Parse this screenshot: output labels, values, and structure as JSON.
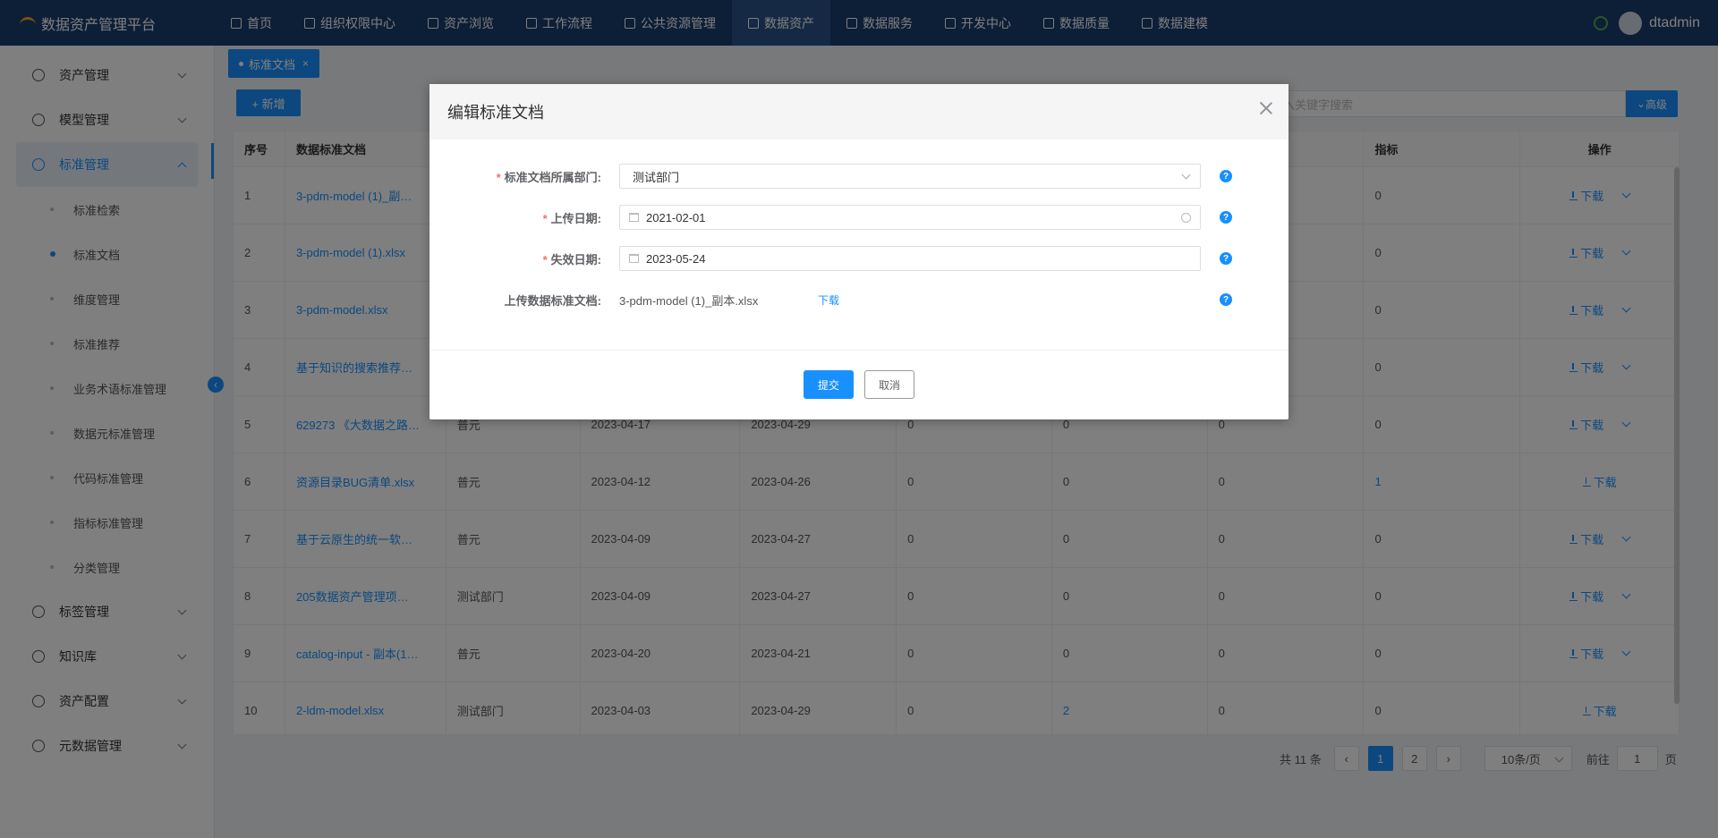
{
  "header": {
    "app_title": "数据资产管理平台",
    "nav": [
      {
        "label": "首页",
        "icon": "home-icon"
      },
      {
        "label": "组织权限中心",
        "icon": "shield-icon"
      },
      {
        "label": "资产浏览",
        "icon": "list-icon"
      },
      {
        "label": "工作流程",
        "icon": "flow-icon"
      },
      {
        "label": "公共资源管理",
        "icon": "resource-icon"
      },
      {
        "label": "数据资产",
        "icon": "asset-icon",
        "active": true
      },
      {
        "label": "数据服务",
        "icon": "service-icon"
      },
      {
        "label": "开发中心",
        "icon": "edit-icon"
      },
      {
        "label": "数据质量",
        "icon": "chart-icon"
      },
      {
        "label": "数据建模",
        "icon": "layers-icon"
      }
    ],
    "username": "dtadmin"
  },
  "sidebar": {
    "items": [
      {
        "label": "资产管理",
        "icon": "clock-icon"
      },
      {
        "label": "模型管理",
        "icon": "model-icon"
      },
      {
        "label": "标准管理",
        "icon": "document-icon",
        "open": true
      },
      {
        "label": "标签管理",
        "icon": "plus-circle-icon"
      },
      {
        "label": "知识库",
        "icon": "tag-icon"
      },
      {
        "label": "资产配置",
        "icon": "target-icon"
      },
      {
        "label": "元数据管理",
        "icon": "layers-icon"
      }
    ],
    "sub_items": [
      {
        "label": "标准检索"
      },
      {
        "label": "标准文档",
        "active": true
      },
      {
        "label": "维度管理"
      },
      {
        "label": "标准推荐"
      },
      {
        "label": "业务术语标准管理"
      },
      {
        "label": "数据元标准管理"
      },
      {
        "label": "代码标准管理"
      },
      {
        "label": "指标标准管理"
      },
      {
        "label": "分类管理"
      }
    ]
  },
  "tab": {
    "label": "标准文档",
    "close": "×"
  },
  "toolbar": {
    "add_label": "+ 新增",
    "search_placeholder": "入关键字搜索",
    "advanced_label": "高级"
  },
  "table": {
    "columns": [
      "序号",
      "数据标准文档",
      "",
      "",
      "",
      "",
      "",
      "",
      "指标",
      "操作"
    ],
    "rows": [
      [
        "1",
        "3-pdm-model (1)_副…",
        "",
        "",
        "",
        "",
        "",
        "",
        "0",
        "下载"
      ],
      [
        "2",
        "3-pdm-model (1).xlsx",
        "",
        "",
        "",
        "",
        "",
        "",
        "0",
        "下载"
      ],
      [
        "3",
        "3-pdm-model.xlsx",
        "",
        "",
        "",
        "",
        "",
        "",
        "0",
        "下载"
      ],
      [
        "4",
        "基于知识的搜索推荐…",
        "",
        "",
        "",
        "",
        "",
        "",
        "0",
        "下载"
      ],
      [
        "5",
        "629273 《大数据之路…",
        "普元",
        "2023-04-17",
        "2023-04-29",
        "0",
        "0",
        "0",
        "0",
        "下载"
      ],
      [
        "6",
        "资源目录BUG清单.xlsx",
        "普元",
        "2023-04-12",
        "2023-04-26",
        "0",
        "0",
        "0",
        "1",
        "下载"
      ],
      [
        "7",
        "基于云原生的统一软…",
        "普元",
        "2023-04-09",
        "2023-04-27",
        "0",
        "0",
        "0",
        "0",
        "下载"
      ],
      [
        "8",
        "205数据资产管理项…",
        "测试部门",
        "2023-04-09",
        "2023-04-27",
        "0",
        "0",
        "0",
        "0",
        "下载"
      ],
      [
        "9",
        "catalog-input - 副本(1…",
        "普元",
        "2023-04-20",
        "2023-04-21",
        "0",
        "0",
        "0",
        "0",
        "下载"
      ],
      [
        "10",
        "2-ldm-model.xlsx",
        "测试部门",
        "2023-04-03",
        "2023-04-29",
        "0",
        "2",
        "0",
        "0",
        "下载"
      ]
    ]
  },
  "pagination": {
    "total": "共 11 条",
    "page1": "1",
    "page2": "2",
    "page_size": "10条/页",
    "goto_label": "前往",
    "goto_value": "1",
    "goto_suffix": "页"
  },
  "dialog": {
    "title": "编辑标准文档",
    "fields": {
      "department_label": "标准文档所属部门:",
      "department_value": "测试部门",
      "upload_date_label": "上传日期:",
      "upload_date_value": "2021-02-01",
      "expiry_date_label": "失效日期:",
      "expiry_date_value": "2023-05-24",
      "file_label": "上传数据标准文档:",
      "file_value": "3-pdm-model (1)_副本.xlsx",
      "download_link": "下载"
    },
    "submit_label": "提交",
    "cancel_label": "取消"
  }
}
